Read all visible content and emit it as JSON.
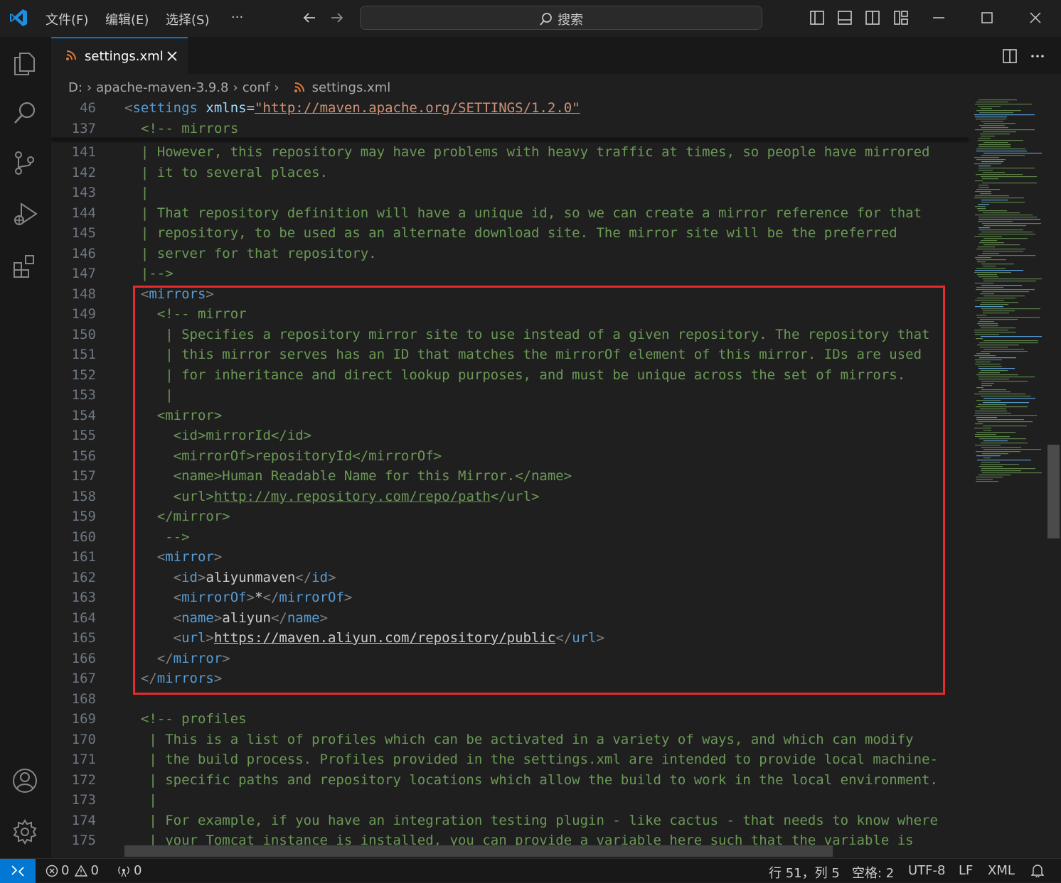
{
  "titlebar": {
    "menu": [
      "文件(F)",
      "编辑(E)",
      "选择(S)",
      "···"
    ],
    "search_placeholder": "搜索"
  },
  "tab": {
    "label": "settings.xml"
  },
  "breadcrumb": [
    "D:",
    "apache-maven-3.9.8",
    "conf",
    "settings.xml"
  ],
  "sticky_lines": [
    {
      "n": "46",
      "segments": [
        [
          "punc",
          "<"
        ],
        [
          "tag",
          "settings"
        ],
        [
          "txt",
          " "
        ],
        [
          "attr",
          "xmlns"
        ],
        [
          "txt",
          "="
        ],
        [
          "str",
          "\"http://maven.apache.org/SETTINGS/1.2.0\""
        ]
      ],
      "indent": 0
    },
    {
      "n": "137",
      "segments": [
        [
          "comment",
          "<!-- mirrors"
        ]
      ],
      "indent": 1
    }
  ],
  "code_lines": [
    {
      "n": "141",
      "segments": [
        [
          "comment",
          "  | However, this repository may have problems with heavy traffic at times, so people have mirrored"
        ]
      ]
    },
    {
      "n": "142",
      "segments": [
        [
          "comment",
          "  | it to several places."
        ]
      ]
    },
    {
      "n": "143",
      "segments": [
        [
          "comment",
          "  |"
        ]
      ]
    },
    {
      "n": "144",
      "segments": [
        [
          "comment",
          "  | That repository definition will have a unique id, so we can create a mirror reference for that"
        ]
      ]
    },
    {
      "n": "145",
      "segments": [
        [
          "comment",
          "  | repository, to be used as an alternate download site. The mirror site will be the preferred"
        ]
      ]
    },
    {
      "n": "146",
      "segments": [
        [
          "comment",
          "  | server for that repository."
        ]
      ]
    },
    {
      "n": "147",
      "segments": [
        [
          "comment",
          "  |-->"
        ]
      ]
    },
    {
      "n": "148",
      "segments": [
        [
          "txt",
          "  "
        ],
        [
          "punc",
          "<"
        ],
        [
          "tag",
          "mirrors"
        ],
        [
          "punc",
          ">"
        ]
      ]
    },
    {
      "n": "149",
      "segments": [
        [
          "comment",
          "    <!-- mirror"
        ]
      ]
    },
    {
      "n": "150",
      "segments": [
        [
          "comment",
          "     | Specifies a repository mirror site to use instead of a given repository. The repository that"
        ]
      ]
    },
    {
      "n": "151",
      "segments": [
        [
          "comment",
          "     | this mirror serves has an ID that matches the mirrorOf element of this mirror. IDs are used"
        ]
      ]
    },
    {
      "n": "152",
      "segments": [
        [
          "comment",
          "     | for inheritance and direct lookup purposes, and must be unique across the set of mirrors."
        ]
      ]
    },
    {
      "n": "153",
      "segments": [
        [
          "comment",
          "     |"
        ]
      ]
    },
    {
      "n": "154",
      "segments": [
        [
          "comment",
          "    <mirror>"
        ]
      ]
    },
    {
      "n": "155",
      "segments": [
        [
          "comment",
          "      <id>mirrorId</id>"
        ]
      ]
    },
    {
      "n": "156",
      "segments": [
        [
          "comment",
          "      <mirrorOf>repositoryId</mirrorOf>"
        ]
      ]
    },
    {
      "n": "157",
      "segments": [
        [
          "comment",
          "      <name>Human Readable Name for this Mirror.</name>"
        ]
      ]
    },
    {
      "n": "158",
      "segments": [
        [
          "comment",
          "      <url>"
        ],
        [
          "commentlink",
          "http://my.repository.com/repo/path"
        ],
        [
          "comment",
          "</url>"
        ]
      ]
    },
    {
      "n": "159",
      "segments": [
        [
          "comment",
          "    </mirror>"
        ]
      ]
    },
    {
      "n": "160",
      "segments": [
        [
          "comment",
          "     -->"
        ]
      ]
    },
    {
      "n": "161",
      "segments": [
        [
          "txt",
          "    "
        ],
        [
          "punc",
          "<"
        ],
        [
          "tag",
          "mirror"
        ],
        [
          "punc",
          ">"
        ]
      ]
    },
    {
      "n": "162",
      "segments": [
        [
          "txt",
          "      "
        ],
        [
          "punc",
          "<"
        ],
        [
          "tag",
          "id"
        ],
        [
          "punc",
          ">"
        ],
        [
          "txt",
          "aliyunmaven"
        ],
        [
          "punc",
          "</"
        ],
        [
          "tag",
          "id"
        ],
        [
          "punc",
          ">"
        ]
      ]
    },
    {
      "n": "163",
      "segments": [
        [
          "txt",
          "      "
        ],
        [
          "punc",
          "<"
        ],
        [
          "tag",
          "mirrorOf"
        ],
        [
          "punc",
          ">"
        ],
        [
          "txt",
          "*"
        ],
        [
          "punc",
          "</"
        ],
        [
          "tag",
          "mirrorOf"
        ],
        [
          "punc",
          ">"
        ]
      ]
    },
    {
      "n": "164",
      "segments": [
        [
          "txt",
          "      "
        ],
        [
          "punc",
          "<"
        ],
        [
          "tag",
          "name"
        ],
        [
          "punc",
          ">"
        ],
        [
          "txt",
          "aliyun"
        ],
        [
          "punc",
          "</"
        ],
        [
          "tag",
          "name"
        ],
        [
          "punc",
          ">"
        ]
      ]
    },
    {
      "n": "165",
      "segments": [
        [
          "txt",
          "      "
        ],
        [
          "punc",
          "<"
        ],
        [
          "tag",
          "url"
        ],
        [
          "punc",
          ">"
        ],
        [
          "link",
          "https://maven.aliyun.com/repository/public"
        ],
        [
          "punc",
          "</"
        ],
        [
          "tag",
          "url"
        ],
        [
          "punc",
          ">"
        ]
      ]
    },
    {
      "n": "166",
      "segments": [
        [
          "txt",
          "    "
        ],
        [
          "punc",
          "</"
        ],
        [
          "tag",
          "mirror"
        ],
        [
          "punc",
          ">"
        ]
      ]
    },
    {
      "n": "167",
      "segments": [
        [
          "txt",
          "  "
        ],
        [
          "punc",
          "</"
        ],
        [
          "tag",
          "mirrors"
        ],
        [
          "punc",
          ">"
        ]
      ]
    },
    {
      "n": "168",
      "segments": []
    },
    {
      "n": "169",
      "segments": [
        [
          "comment",
          "  <!-- profiles"
        ]
      ]
    },
    {
      "n": "170",
      "segments": [
        [
          "comment",
          "   | This is a list of profiles which can be activated in a variety of ways, and which can modify"
        ]
      ]
    },
    {
      "n": "171",
      "segments": [
        [
          "comment",
          "   | the build process. Profiles provided in the settings.xml are intended to provide local machine-"
        ]
      ]
    },
    {
      "n": "172",
      "segments": [
        [
          "comment",
          "   | specific paths and repository locations which allow the build to work in the local environment."
        ]
      ]
    },
    {
      "n": "173",
      "segments": [
        [
          "comment",
          "   |"
        ]
      ]
    },
    {
      "n": "174",
      "segments": [
        [
          "comment",
          "   | For example, if you have an integration testing plugin - like cactus - that needs to know where"
        ]
      ]
    },
    {
      "n": "175",
      "segments": [
        [
          "comment",
          "   | your Tomcat instance is installed, you can provide a variable here such that the variable is"
        ]
      ]
    }
  ],
  "statusbar": {
    "errors": "0",
    "warnings": "0",
    "ports": "0",
    "cursor": "行 51，列 5",
    "indent": "空格: 2",
    "encoding": "UTF-8",
    "eol": "LF",
    "language": "XML"
  },
  "colors": {
    "accent": "#0078d4",
    "highlight_box": "#e52b2b",
    "comment": "#6a9955",
    "tag": "#569cd6",
    "string": "#ce9178"
  }
}
